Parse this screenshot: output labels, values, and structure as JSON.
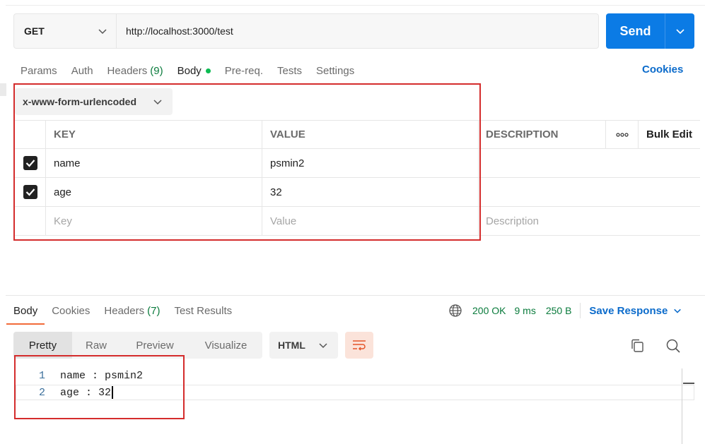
{
  "request": {
    "method": "GET",
    "url": "http://localhost:3000/test",
    "send_label": "Send"
  },
  "request_tabs": {
    "params": "Params",
    "auth": "Auth",
    "headers": "Headers",
    "headers_count": "(9)",
    "body": "Body",
    "prereq": "Pre-req.",
    "tests": "Tests",
    "settings": "Settings",
    "cookies": "Cookies"
  },
  "body_type": "x-www-form-urlencoded",
  "table": {
    "col_key": "KEY",
    "col_value": "VALUE",
    "col_description": "DESCRIPTION",
    "more": "ooo",
    "bulk_edit": "Bulk Edit",
    "rows": [
      {
        "key": "name",
        "value": "psmin2",
        "checked": true
      },
      {
        "key": "age",
        "value": "32",
        "checked": true
      }
    ],
    "placeholder_key": "Key",
    "placeholder_value": "Value",
    "placeholder_description": "Description"
  },
  "response_tabs": {
    "body": "Body",
    "cookies": "Cookies",
    "headers": "Headers",
    "headers_count": "(7)",
    "test_results": "Test Results"
  },
  "response_meta": {
    "status": "200 OK",
    "time": "9 ms",
    "size": "250 B",
    "save_response": "Save Response"
  },
  "view_tabs": [
    "Pretty",
    "Raw",
    "Preview",
    "Visualize"
  ],
  "format": "HTML",
  "code_lines": [
    {
      "num": "1",
      "text": "name : psmin2"
    },
    {
      "num": "2",
      "text": "age : 32"
    }
  ],
  "colors": {
    "accent": "#0b7be5",
    "active_tab": "#f26b3a",
    "status_ok": "#0a7b3c",
    "highlight_box": "#d42c2c"
  }
}
